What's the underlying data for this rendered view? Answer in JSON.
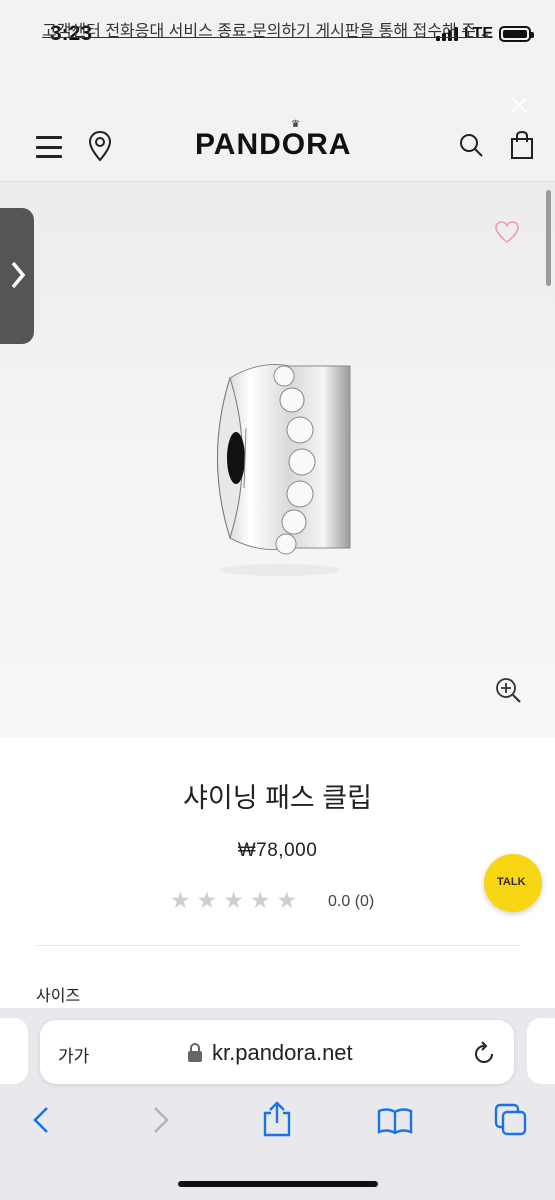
{
  "status": {
    "time": "3:23",
    "network": "LTE"
  },
  "notice": {
    "text": "고객센터 전화응대 서비스 종료-문의하기 게시판을 통해 접수해 주..."
  },
  "header": {
    "logo": "PANDORA"
  },
  "product": {
    "name": "샤이닝 패스 클립",
    "price": "₩78,000",
    "rating_text": "0.0 (0)",
    "rating_value": 0,
    "rating_max": 5
  },
  "chat": {
    "label": "TALK"
  },
  "options": {
    "size_label": "사이즈"
  },
  "browser": {
    "aa_label": "가가",
    "url": "kr.pandora.net"
  },
  "colors": {
    "accent_heart": "#e7a1b0",
    "kakao_yellow": "#f7d613",
    "ios_blue": "#1a73e8"
  },
  "icons": [
    "menu-icon",
    "map-pin-icon",
    "search-icon",
    "bag-icon",
    "heart-icon",
    "zoom-in-icon",
    "close-icon",
    "chevron-right-icon",
    "lock-icon",
    "reload-icon",
    "back-icon",
    "forward-icon",
    "share-icon",
    "bookmarks-icon",
    "tabs-icon"
  ]
}
